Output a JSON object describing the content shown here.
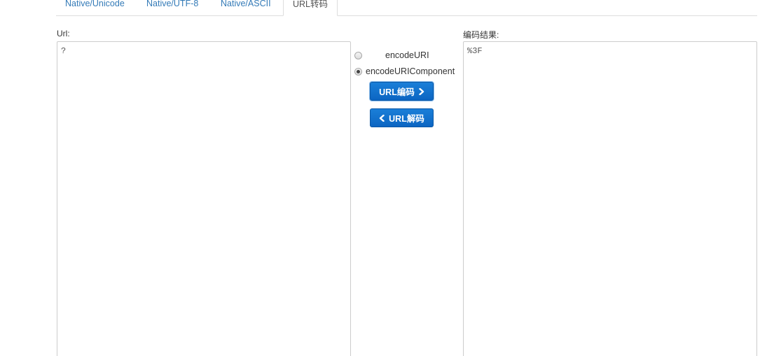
{
  "tabs": [
    {
      "label": "Native/Unicode"
    },
    {
      "label": "Native/UTF-8"
    },
    {
      "label": "Native/ASCII"
    },
    {
      "label": "URL转码"
    }
  ],
  "input": {
    "label": "Url:",
    "value": "?"
  },
  "output": {
    "label": "编码结果:",
    "value": "%3F"
  },
  "options": {
    "encode_uri_label": "encodeURI",
    "encode_uri_component_label": "encodeURIComponent",
    "selected": "encodeURIComponent"
  },
  "buttons": {
    "encode_label": "URL编码",
    "decode_label": "URL解码",
    "encode_icon": "chevron-right-icon",
    "decode_icon": "chevron-left-icon"
  },
  "colors": {
    "link": "#337ab7",
    "button_blue": "#0c65c2",
    "border": "#cccccc"
  }
}
